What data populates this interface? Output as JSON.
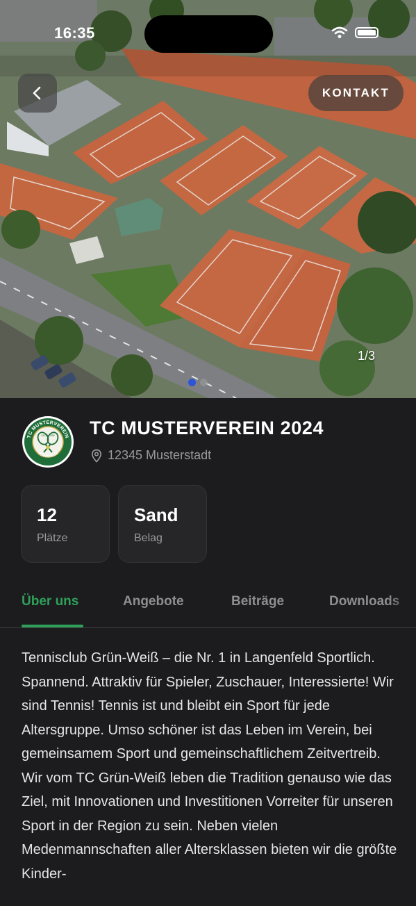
{
  "status_bar": {
    "time": "16:35"
  },
  "hero": {
    "image_counter": "1/3",
    "slide_count": 3,
    "active_slide": 1,
    "contact_label": "KONTAKT"
  },
  "club": {
    "name": "TC MUSTERVEREIN 2024",
    "location": "12345 Musterstadt",
    "logo": {
      "top_text": "TC MUSTERVEREIN",
      "bottom_text": "TENNISCLUB",
      "year": "GEGR. 1959"
    }
  },
  "stats": [
    {
      "value": "12",
      "label": "Plätze"
    },
    {
      "value": "Sand",
      "label": "Belag"
    }
  ],
  "tabs": [
    {
      "label": "Über uns",
      "active": true
    },
    {
      "label": "Angebote",
      "active": false
    },
    {
      "label": "Beiträge",
      "active": false
    },
    {
      "label": "Downloads",
      "active": false
    }
  ],
  "description": "Tennisclub Grün-Weiß – die Nr. 1 in Langenfeld Sportlich. Spannend. Attraktiv für Spieler, Zuschauer, Interessierte!  Wir sind Tennis!  Tennis ist und bleibt ein Sport für jede Altersgruppe. Umso schöner ist das Leben im Verein, bei gemeinsamem Sport und gemeinschaftlichem Zeitvertreib. Wir vom TC Grün-Weiß leben die Tradition genauso wie das Ziel, mit Innovationen und Investitionen Vorreiter für unseren Sport in der Region zu sein. Neben vielen Medenmannschaften aller Altersklassen bieten wir die größte Kinder-",
  "colors": {
    "accent": "#2fa05a",
    "background": "#1c1c1e",
    "clay": "#c5673f",
    "page_dot": "#2f54d8"
  },
  "icons": {
    "back": "chevron-left-icon",
    "location": "location-pin-icon",
    "wifi": "wifi-icon",
    "battery": "battery-icon"
  }
}
